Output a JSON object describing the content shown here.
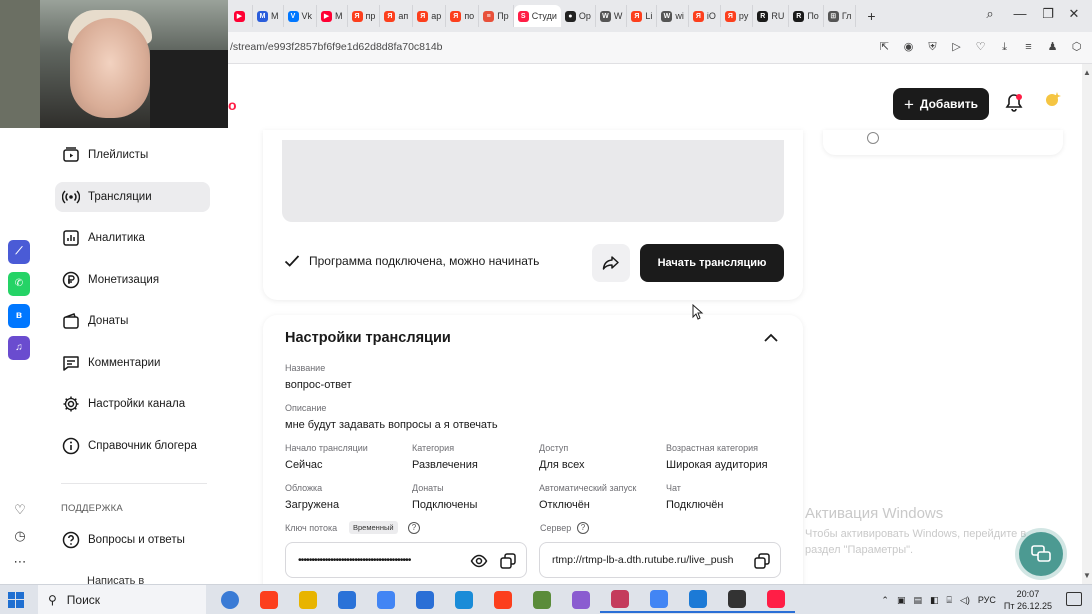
{
  "browser": {
    "tabs": [
      {
        "label": "",
        "color": "#ff0033",
        "glyph": "▶"
      },
      {
        "label": "M",
        "color": "#2a5ddb",
        "glyph": "M"
      },
      {
        "label": "Vk",
        "color": "#0077ff",
        "glyph": "V"
      },
      {
        "label": "M",
        "color": "#ff0033",
        "glyph": "▶"
      },
      {
        "label": "пр",
        "color": "#fc3f1d",
        "glyph": "Я"
      },
      {
        "label": "ап",
        "color": "#fc3f1d",
        "glyph": "Я"
      },
      {
        "label": "ар",
        "color": "#fc3f1d",
        "glyph": "Я"
      },
      {
        "label": "по",
        "color": "#fc3f1d",
        "glyph": "Я"
      },
      {
        "label": "Пр",
        "color": "#e8503a",
        "glyph": "≡"
      },
      {
        "label": "Студи",
        "color": "#ff1e46",
        "glyph": "S",
        "active": true
      },
      {
        "label": "Ор",
        "color": "#222222",
        "glyph": "●"
      },
      {
        "label": "W",
        "color": "#555555",
        "glyph": "W"
      },
      {
        "label": "Li",
        "color": "#fc3f1d",
        "glyph": "Я"
      },
      {
        "label": "wi",
        "color": "#555555",
        "glyph": "W"
      },
      {
        "label": "iO",
        "color": "#fc3f1d",
        "glyph": "Я"
      },
      {
        "label": "ру",
        "color": "#fc3f1d",
        "glyph": "Я"
      },
      {
        "label": "RU",
        "color": "#1a1a1a",
        "glyph": "R"
      },
      {
        "label": "По",
        "color": "#1a1a1a",
        "glyph": "R"
      },
      {
        "label": "Гл",
        "color": "#555555",
        "glyph": "⊞"
      }
    ],
    "new_tab": "+",
    "url": "/stream/e993f2857bf6f9e1d62d8d8fa70c814b"
  },
  "header": {
    "add_button": "Добавить",
    "add_plus": "+"
  },
  "sidebar": {
    "items": [
      {
        "label": "Плейлисты",
        "icon": "playlist-icon"
      },
      {
        "label": "Трансляции",
        "icon": "broadcast-icon",
        "active": true
      },
      {
        "label": "Аналитика",
        "icon": "analytics-icon"
      },
      {
        "label": "Монетизация",
        "icon": "ruble-icon"
      },
      {
        "label": "Донаты",
        "icon": "wallet-icon"
      },
      {
        "label": "Комментарии",
        "icon": "comment-icon"
      },
      {
        "label": "Настройки канала",
        "icon": "gear-icon"
      },
      {
        "label": "Справочник блогера",
        "icon": "info-icon"
      }
    ],
    "support_title": "ПОДДЕРЖКА",
    "support_item": "Вопросы и ответы",
    "cut_item": "Написать в"
  },
  "broadcast": {
    "status": "Программа подключена, можно начинать",
    "start_button": "Начать трансляцию"
  },
  "settings": {
    "title": "Настройки трансляции",
    "name_label": "Название",
    "name_value": "вопрос-ответ",
    "desc_label": "Описание",
    "desc_value": "мне будут задавать вопросы а я отвечать",
    "start_label": "Начало трансляции",
    "start_value": "Сейчас",
    "category_label": "Категория",
    "category_value": "Развлечения",
    "access_label": "Доступ",
    "access_value": "Для всех",
    "age_label": "Возрастная категория",
    "age_value": "Широкая аудитория",
    "cover_label": "Обложка",
    "cover_value": "Загружена",
    "donations_label": "Донаты",
    "donations_value": "Подключены",
    "autostart_label": "Автоматический запуск",
    "autostart_value": "Отключён",
    "chat_label": "Чат",
    "chat_value": "Подключён",
    "key_label": "Ключ потока",
    "key_badge": "Временный",
    "key_value": "••••••••••••••••••••••••••••••••••••••••••",
    "server_label": "Сервер",
    "server_value": "rtmp://rtmp-lb-a.dth.rutube.ru/live_push"
  },
  "watermark": {
    "title": "Активация Windows",
    "text": "Чтобы активировать Windows, перейдите в раздел \"Параметры\"."
  },
  "taskbar": {
    "search": "Поиск",
    "lang": "РУС",
    "time": "20:07",
    "date": "Пт 26.12.25",
    "apps": [
      "#3a7bd5",
      "#fc3f1d",
      "#e8b400",
      "#2a72d8",
      "#4285f4",
      "#2a6fd6",
      "#1a8cd8",
      "#fc3f1d",
      "#5a8c3a",
      "#8a5cd0",
      "#c43b5c",
      "#4285f4",
      "#1c7ad6",
      "#333333",
      "#ff1e46"
    ]
  }
}
